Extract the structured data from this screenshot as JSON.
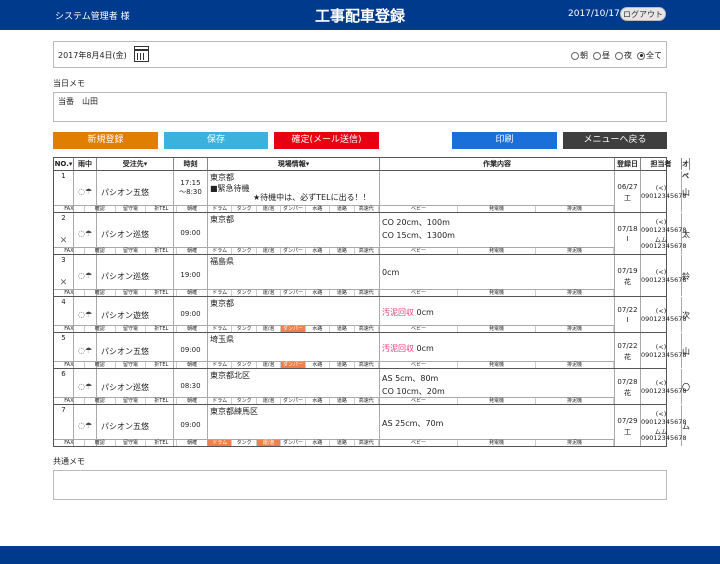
{
  "header": {
    "user": "システム管理者 様",
    "title": "工事配車登録",
    "date": "2017/10/17",
    "logout_label": "ログアウト"
  },
  "filter": {
    "date": "2017年8月4日(金)",
    "options": [
      "朝",
      "昼",
      "夜",
      "全て"
    ],
    "selected": "全て"
  },
  "day_memo": {
    "label": "当日メモ",
    "value": "当番　山田"
  },
  "buttons": {
    "new": "新規登録",
    "save": "保存",
    "confirm": "確定(メール送信)",
    "print": "印刷",
    "menu": "メニューへ戻る"
  },
  "table": {
    "headers": [
      "NO.▾",
      "雨中",
      "受注先▾",
      "時刻",
      "現場情報▾",
      "作業内容",
      "登録日",
      "担当者",
      "オペ"
    ],
    "left_tags": [
      "FAX",
      "確認",
      "留守電",
      "折TEL",
      "朝確"
    ],
    "site_tags": [
      "ドラム",
      "タンク",
      "運/泡",
      "ダンパー",
      "水路",
      "道路",
      "高速代"
    ],
    "work_tags": [
      "ベビー",
      "発電機",
      "排泥機"
    ],
    "rows": [
      {
        "no": "1",
        "x": "",
        "client": "パシオン五悠",
        "time": "17:15\n〜8:30",
        "site": "東京都\n■緊急待機",
        "site_note": "★待機中は、必ずTELに出る！！",
        "work": [],
        "reg_date": "06/27",
        "reg_by": "工",
        "staff": [
          "(<)",
          "09012345678"
        ],
        "op": "山",
        "hl": []
      },
      {
        "no": "2",
        "x": "✕",
        "client": "パシオン巡悠",
        "time": "09:00",
        "site": "東京都",
        "site_note": "",
        "work": [
          "CO 20cm、100m",
          "CO 15cm、1300m"
        ],
        "reg_date": "07/18",
        "reg_by": "I",
        "staff": [
          "(<)",
          "09012345678",
          "ムム",
          "09012345678"
        ],
        "op": "太",
        "hl": []
      },
      {
        "no": "3",
        "x": "✕",
        "client": "パシオン巡悠",
        "time": "19:00",
        "site": "福島県",
        "site_note": "",
        "work": [
          "0cm"
        ],
        "reg_date": "07/19",
        "reg_by": "花",
        "staff": [
          "(<)",
          "09012345678"
        ],
        "op": "鈴",
        "hl": []
      },
      {
        "no": "4",
        "x": "",
        "client": "パシオン遊悠",
        "time": "09:00",
        "site": "東京都",
        "site_note": "",
        "work": [
          "汚泥回収 0cm"
        ],
        "reg_date": "07/22",
        "reg_by": "I",
        "staff": [
          "(<)",
          "09012345678"
        ],
        "op": "次",
        "hl": [
          "ダンパー"
        ]
      },
      {
        "no": "5",
        "x": "",
        "client": "パシオン五悠",
        "time": "09:00",
        "site": "埼玉県",
        "site_note": "",
        "work": [
          "汚泥回収 0cm"
        ],
        "reg_date": "07/22",
        "reg_by": "花",
        "staff": [
          "(<)",
          "09012345678"
        ],
        "op": "山",
        "hl": [
          "ダンパー"
        ]
      },
      {
        "no": "6",
        "x": "",
        "client": "パシオン巡悠",
        "time": "08:30",
        "site": "東京都北区",
        "site_note": "",
        "work": [
          "AS 5cm、80m",
          "CO 10cm、20m"
        ],
        "reg_date": "07/28",
        "reg_by": "花",
        "staff": [
          "(<)",
          "09012345678"
        ],
        "op": "〇",
        "hl": []
      },
      {
        "no": "7",
        "x": "",
        "client": "パシオン五悠",
        "time": "09:00",
        "site": "東京都練馬区",
        "site_note": "",
        "work": [
          "AS 25cm、70m"
        ],
        "reg_date": "07/29",
        "reg_by": "工",
        "staff": [
          "(<)",
          "09012345678",
          "ムム",
          "09012345678"
        ],
        "op": "ム",
        "hl": [
          "ドラム",
          "運/泡"
        ]
      }
    ]
  },
  "common_memo": {
    "label": "共通メモ",
    "value": ""
  }
}
